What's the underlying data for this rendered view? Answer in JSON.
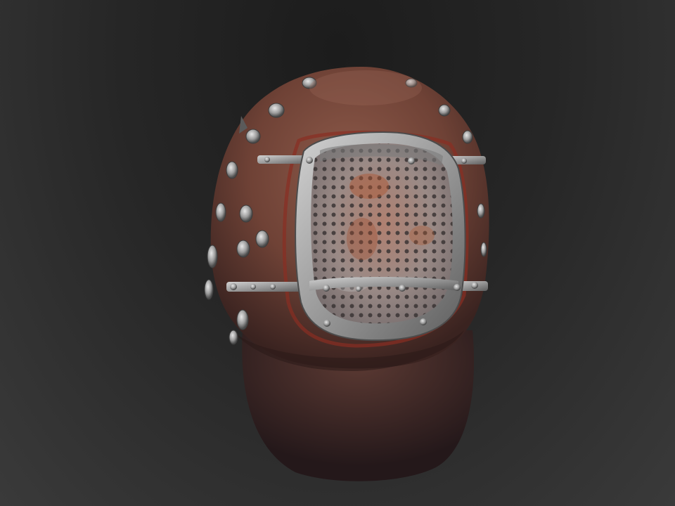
{
  "scene": {
    "subject": "mask-sculpt",
    "colors": {
      "background_top": "#1c1c1c",
      "background_bottom": "#3a3a3a",
      "leather": "#7a4a3c",
      "leather_dark": "#3e2420",
      "metal": "#a8a8a8",
      "metal_dark": "#5c5c5c",
      "rust": "#a0552e"
    },
    "icons": [
      "rivet",
      "mesh-grille",
      "metal-strap"
    ]
  }
}
